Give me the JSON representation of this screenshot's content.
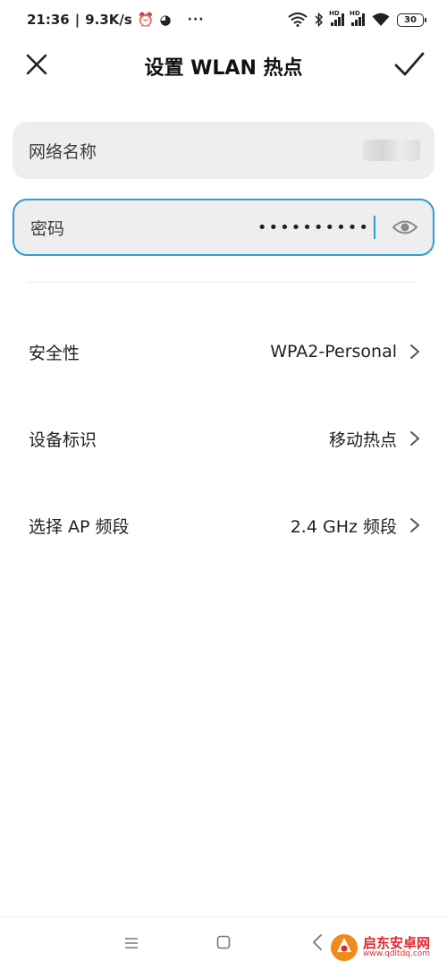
{
  "status_bar": {
    "time": "21:36",
    "speed": "9.3K/s",
    "more": "···",
    "battery": "30",
    "signal_badge": "HD"
  },
  "header": {
    "title": "设置 WLAN 热点"
  },
  "fields": {
    "ssid_label": "网络名称",
    "password_label": "密码",
    "password_value": "••••••••••"
  },
  "settings": [
    {
      "label": "安全性",
      "value": "WPA2-Personal"
    },
    {
      "label": "设备标识",
      "value": "移动热点"
    },
    {
      "label": "选择 AP 频段",
      "value": "2.4 GHz 频段"
    }
  ],
  "watermark": {
    "name": "启东安卓网",
    "url": "www.qdltdq.com"
  },
  "colors": {
    "accent": "#2a9fd6",
    "field_bg": "#eeeeee",
    "watermark": "#e0262e"
  }
}
